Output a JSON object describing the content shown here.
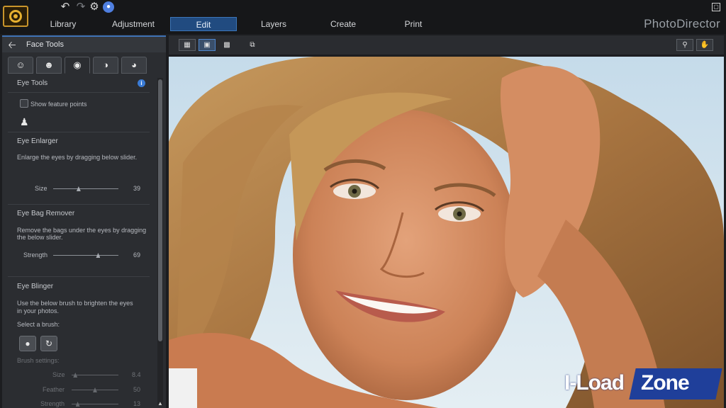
{
  "app": {
    "brand": "PhotoDirector"
  },
  "quick_actions": {
    "undo": "↶",
    "redo": "↷",
    "settings": "⚙",
    "notify": "🔔"
  },
  "nav": {
    "tabs": [
      "Library",
      "Adjustment",
      "Edit",
      "Layers",
      "Create",
      "Print"
    ],
    "active": "Edit"
  },
  "panel": {
    "title": "Face Tools",
    "face_tabs": [
      "face-shape",
      "face-detail",
      "eye",
      "eye-lid",
      "lips"
    ],
    "eye_tools": {
      "heading": "Eye Tools",
      "show_feature_points": "Show feature points"
    },
    "eye_enlarger": {
      "heading": "Eye Enlarger",
      "description": "Enlarge the eyes by dragging below slider.",
      "size_label": "Size",
      "size_value": "39",
      "size_fraction": 0.39
    },
    "eye_bag_remover": {
      "heading": "Eye Bag Remover",
      "description_line1": "Remove the bags under the eyes by dragging",
      "description_line2": "the below slider.",
      "strength_label": "Strength",
      "strength_value": "69",
      "strength_fraction": 0.69
    },
    "eye_blinger": {
      "heading": "Eye Blinger",
      "description_line1": "Use the below brush to brighten the eyes",
      "description_line2": "in your photos.",
      "select_brush": "Select a brush:",
      "brush_settings": "Brush settings:",
      "size_label": "Size",
      "size_value": "8.4",
      "size_fraction": 0.08,
      "feather_label": "Feather",
      "feather_value": "50",
      "feather_fraction": 0.5,
      "strength_label": "Strength",
      "strength_value": "13",
      "strength_fraction": 0.13
    }
  },
  "watermark": {
    "left": "I-Load",
    "right": "Zone"
  },
  "colors": {
    "accent": "#214b80",
    "panel": "#2b2d31",
    "brand_logo": "#e6b030"
  }
}
